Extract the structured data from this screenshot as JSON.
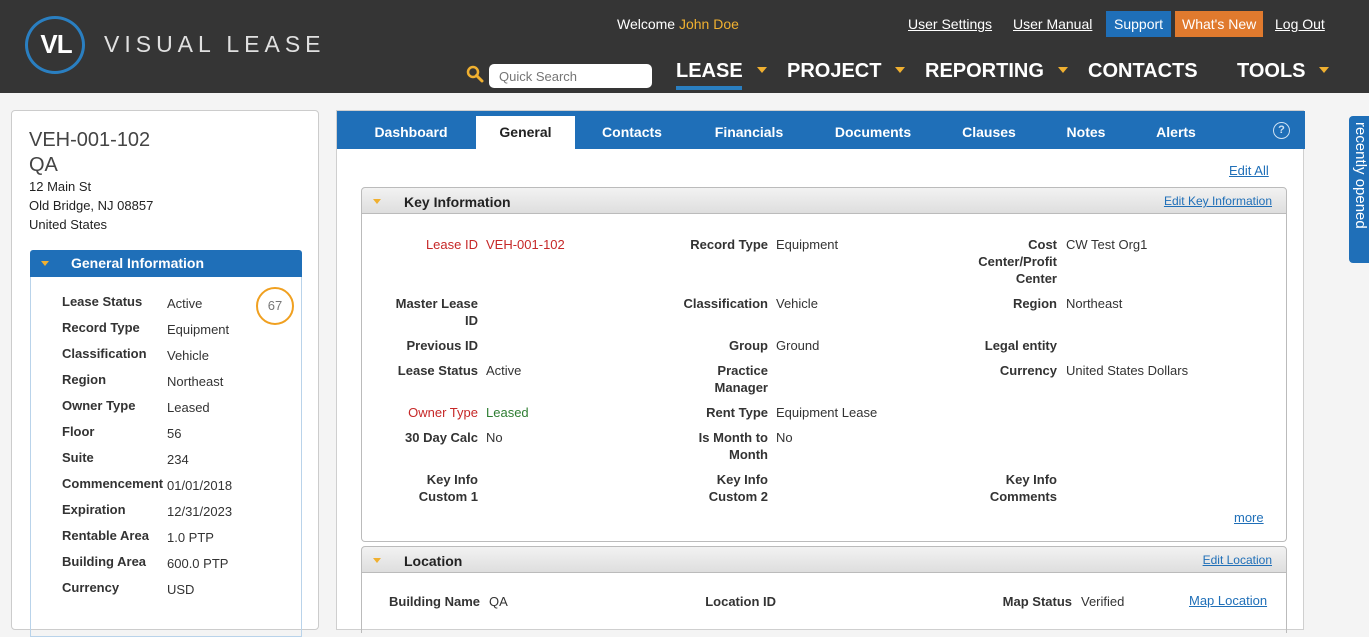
{
  "header": {
    "logo_mark": "VL",
    "logo_text": "VISUAL LEASE",
    "welcome_prefix": "Welcome ",
    "user_name": "John Doe",
    "links": {
      "user_settings": "User Settings",
      "user_manual": "User Manual",
      "support": "Support",
      "whats_new": "What's New",
      "log_out": "Log Out"
    },
    "search_placeholder": "Quick Search",
    "nav": [
      {
        "label": "LEASE",
        "has_caret": true,
        "active": true
      },
      {
        "label": "PROJECT",
        "has_caret": true
      },
      {
        "label": "REPORTING",
        "has_caret": true
      },
      {
        "label": "CONTACTS",
        "has_caret": false
      },
      {
        "label": "TOOLS",
        "has_caret": true
      }
    ],
    "colors": {
      "bg": "#353535",
      "accent_blue": "#1f6fb8",
      "accent_orange": "#e07a2e",
      "caret_yellow": "#f0b030"
    }
  },
  "summary": {
    "lease_id": "VEH-001-102",
    "name": "QA",
    "address_line1": "12 Main St",
    "address_line2": "Old Bridge, NJ 08857",
    "address_line3": "United States",
    "general_info_title": "General Information",
    "score": "67",
    "fields": [
      {
        "label": "Lease Status",
        "value": "Active"
      },
      {
        "label": "Record Type",
        "value": "Equipment"
      },
      {
        "label": "Classification",
        "value": "Vehicle"
      },
      {
        "label": "Region",
        "value": "Northeast"
      },
      {
        "label": "Owner Type",
        "value": "Leased"
      },
      {
        "label": "Floor",
        "value": "56"
      },
      {
        "label": "Suite",
        "value": "234"
      },
      {
        "label": "Commencement",
        "value": "01/01/2018"
      },
      {
        "label": "Expiration",
        "value": "12/31/2023"
      },
      {
        "label": "Rentable Area",
        "value": "1.0 PTP"
      },
      {
        "label": "Building Area",
        "value": "600.0 PTP"
      },
      {
        "label": "Currency",
        "value": "USD"
      }
    ]
  },
  "tabs": [
    "Dashboard",
    "General",
    "Contacts",
    "Financials",
    "Documents",
    "Clauses",
    "Notes",
    "Alerts"
  ],
  "active_tab": "General",
  "edit_all": "Edit All",
  "key_info": {
    "title": "Key Information",
    "edit": "Edit Key Information",
    "more": "more",
    "col1": [
      {
        "label": "Lease ID",
        "value": "VEH-001-102"
      },
      {
        "label": "Master Lease ID",
        "value": ""
      },
      {
        "label": "Previous ID",
        "value": ""
      },
      {
        "label": "Lease Status",
        "value": "Active"
      },
      {
        "label": "Owner Type",
        "value": "Leased"
      },
      {
        "label": "30 Day Calc",
        "value": "No"
      },
      {
        "label": "Key Info Custom 1",
        "value": ""
      }
    ],
    "col2": [
      {
        "label": "Record Type",
        "value": "Equipment"
      },
      {
        "label": "Classification",
        "value": "Vehicle"
      },
      {
        "label": "Group",
        "value": "Ground"
      },
      {
        "label": "Practice Manager",
        "value": ""
      },
      {
        "label": "Rent Type",
        "value": "Equipment Lease"
      },
      {
        "label": "Is Month to Month",
        "value": "No"
      },
      {
        "label": "Key Info Custom 2",
        "value": ""
      }
    ],
    "col3": [
      {
        "label": "Cost Center/Profit Center",
        "value": "CW Test Org1"
      },
      {
        "label": "Region",
        "value": "Northeast"
      },
      {
        "label": "Legal entity",
        "value": ""
      },
      {
        "label": "Currency",
        "value": "United States Dollars"
      },
      {
        "label": "Key Info Comments",
        "value": ""
      }
    ]
  },
  "location": {
    "title": "Location",
    "edit": "Edit Location",
    "building_name_label": "Building Name",
    "building_name_value": "QA",
    "location_id_label": "Location ID",
    "location_id_value": "",
    "map_status_label": "Map Status",
    "map_status_value": "Verified",
    "map_location": "Map Location"
  },
  "recently_opened": "recently opened"
}
